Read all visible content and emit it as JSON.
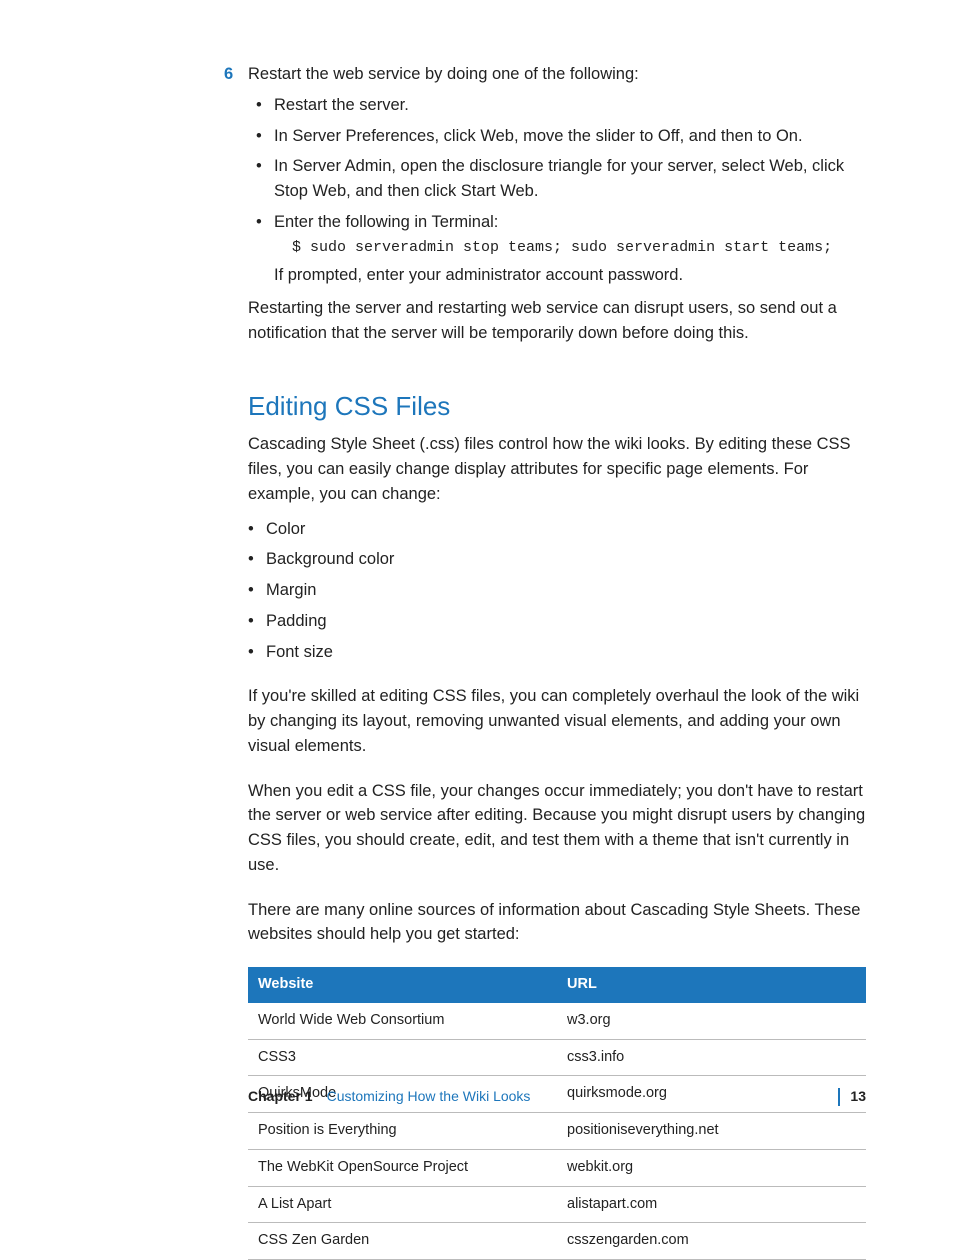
{
  "step6": {
    "number": "6",
    "text": "Restart the web service by doing one of the following:",
    "bullets": [
      "Restart the server.",
      "In Server Preferences, click Web, move the slider to Off, and then to On.",
      "In Server Admin, open the disclosure triangle for your server, select Web, click Stop Web, and then click Start Web.",
      "Enter the following in Terminal:"
    ],
    "code": "$ sudo serveradmin stop teams; sudo serveradmin start teams;",
    "after_code": "If prompted, enter your administrator account password.",
    "closing": "Restarting the server and restarting web service can disrupt users, so send out a notification that the server will be temporarily down before doing this."
  },
  "section": {
    "heading": "Editing CSS Files",
    "intro": "Cascading Style Sheet (.css) files control how the wiki looks. By editing these CSS files, you can easily change display attributes for specific page elements. For example, you can change:",
    "attrs": [
      "Color",
      "Background color",
      "Margin",
      "Padding",
      "Font size"
    ],
    "p2": "If you're skilled at editing CSS files, you can completely overhaul the look of the wiki by changing its layout, removing unwanted visual elements, and adding your own visual elements.",
    "p3": "When you edit a CSS file, your changes occur immediately; you don't have to restart the server or web service after editing. Because you might disrupt users by changing CSS files, you should create, edit, and test them with a theme that isn't currently in use.",
    "p4": "There are many online sources of information about Cascading Style Sheets. These websites should help you get started:"
  },
  "table": {
    "headers": [
      "Website",
      "URL"
    ],
    "rows": [
      [
        "World Wide Web Consortium",
        "w3.org"
      ],
      [
        "CSS3",
        "css3.info"
      ],
      [
        "QuirksMode",
        "quirksmode.org"
      ],
      [
        "Position is Everything",
        "positioniseverything.net"
      ],
      [
        "The WebKit OpenSource Project",
        "webkit.org"
      ],
      [
        "A List Apart",
        "alistapart.com"
      ],
      [
        "CSS Zen Garden",
        "csszengarden.com"
      ]
    ]
  },
  "footer": {
    "chapter": "Chapter 1",
    "title": "Customizing How the Wiki Looks",
    "page": "13"
  }
}
